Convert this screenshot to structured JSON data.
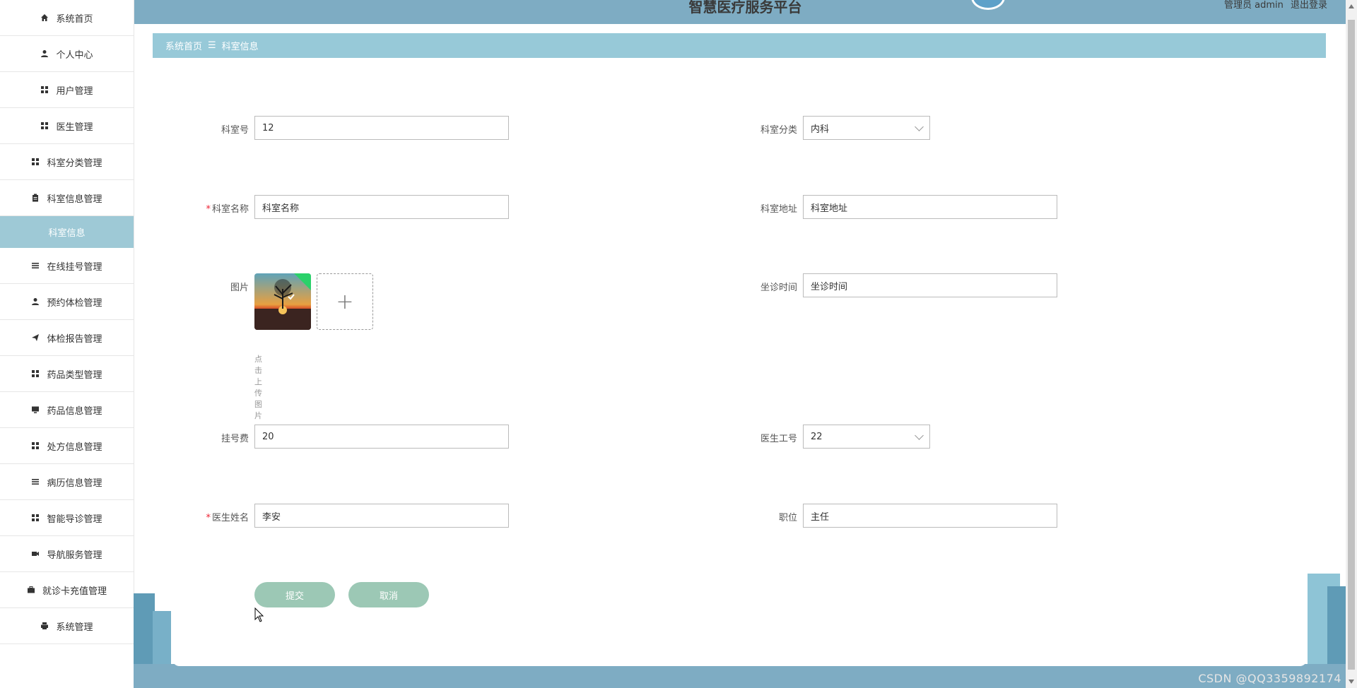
{
  "header": {
    "title": "智慧医疗服务平台",
    "user_label": "管理员 admin",
    "logout": "退出登录"
  },
  "breadcrumb": {
    "home": "系统首页",
    "separator": "☰",
    "current": "科室信息"
  },
  "sidebar": {
    "items": [
      {
        "label": "系统首页",
        "icon": "home-icon"
      },
      {
        "label": "个人中心",
        "icon": "user-icon"
      },
      {
        "label": "用户管理",
        "icon": "grid-icon"
      },
      {
        "label": "医生管理",
        "icon": "grid-icon"
      },
      {
        "label": "科室分类管理",
        "icon": "grid-icon"
      },
      {
        "label": "科室信息管理",
        "icon": "clipboard-icon"
      },
      {
        "label": "科室信息",
        "icon": ""
      },
      {
        "label": "在线挂号管理",
        "icon": "list-icon"
      },
      {
        "label": "预约体检管理",
        "icon": "user-icon"
      },
      {
        "label": "体检报告管理",
        "icon": "send-icon"
      },
      {
        "label": "药品类型管理",
        "icon": "grid-icon"
      },
      {
        "label": "药品信息管理",
        "icon": "monitor-icon"
      },
      {
        "label": "处方信息管理",
        "icon": "grid-icon"
      },
      {
        "label": "病历信息管理",
        "icon": "list-icon"
      },
      {
        "label": "智能导诊管理",
        "icon": "grid-icon"
      },
      {
        "label": "导航服务管理",
        "icon": "video-icon"
      },
      {
        "label": "就诊卡充值管理",
        "icon": "briefcase-icon"
      },
      {
        "label": "系统管理",
        "icon": "printer-icon"
      }
    ]
  },
  "form": {
    "dept_no": {
      "label": "科室号",
      "value": "12"
    },
    "dept_category": {
      "label": "科室分类",
      "value": "内科"
    },
    "dept_name": {
      "label": "科室名称",
      "value": "科室名称",
      "required": "*"
    },
    "dept_address": {
      "label": "科室地址",
      "value": "科室地址"
    },
    "image": {
      "label": "图片",
      "upload_hint": "点击上传图片"
    },
    "clinic_time": {
      "label": "坐诊时间",
      "value": "坐诊时间"
    },
    "fee": {
      "label": "挂号费",
      "value": "20"
    },
    "doctor_id": {
      "label": "医生工号",
      "value": "22"
    },
    "doctor_name": {
      "label": "医生姓名",
      "value": "李安",
      "required": "*"
    },
    "position": {
      "label": "职位",
      "value": "主任"
    },
    "submit_label": "提交",
    "cancel_label": "取消"
  },
  "watermark": "CSDN @QQ3359892174",
  "colors": {
    "header_bg": "#7eacc3",
    "breadcrumb_bg": "#97c9d8",
    "active_nav_bg": "#9ec9d6",
    "button_bg": "#9cc8b5"
  }
}
